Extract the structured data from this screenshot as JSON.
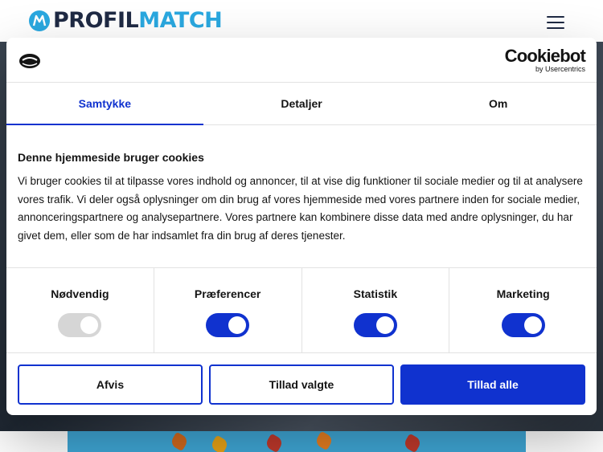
{
  "site": {
    "logo_part1": "PROFIL",
    "logo_part2": "MATCH",
    "brand_color": "#2aa8e0",
    "menu_icon": "hamburger-menu-icon"
  },
  "dialog": {
    "brand": "Cookiebot",
    "brand_sub": "by Usercentrics",
    "tabs": [
      {
        "label": "Samtykke",
        "active": true
      },
      {
        "label": "Detaljer",
        "active": false
      },
      {
        "label": "Om",
        "active": false
      }
    ],
    "heading": "Denne hjemmeside bruger cookies",
    "text": "Vi bruger cookies til at tilpasse vores indhold og annoncer, til at vise dig funktioner til sociale medier og til at analysere vores trafik. Vi deler også oplysninger om din brug af vores hjemmeside med vores partnere inden for sociale medier, annonceringspartnere og analysepartnere. Vores partnere kan kombinere disse data med andre oplysninger, du har givet dem, eller som de har indsamlet fra din brug af deres tjenester.",
    "preferences": [
      {
        "label": "Nødvendig",
        "enabled": true,
        "disabled": true
      },
      {
        "label": "Præferencer",
        "enabled": true,
        "disabled": false
      },
      {
        "label": "Statistik",
        "enabled": true,
        "disabled": false
      },
      {
        "label": "Marketing",
        "enabled": true,
        "disabled": false
      }
    ],
    "buttons": {
      "decline": "Afvis",
      "allow_selected": "Tillad valgte",
      "allow_all": "Tillad alle"
    },
    "accent_color": "#1032cf"
  }
}
